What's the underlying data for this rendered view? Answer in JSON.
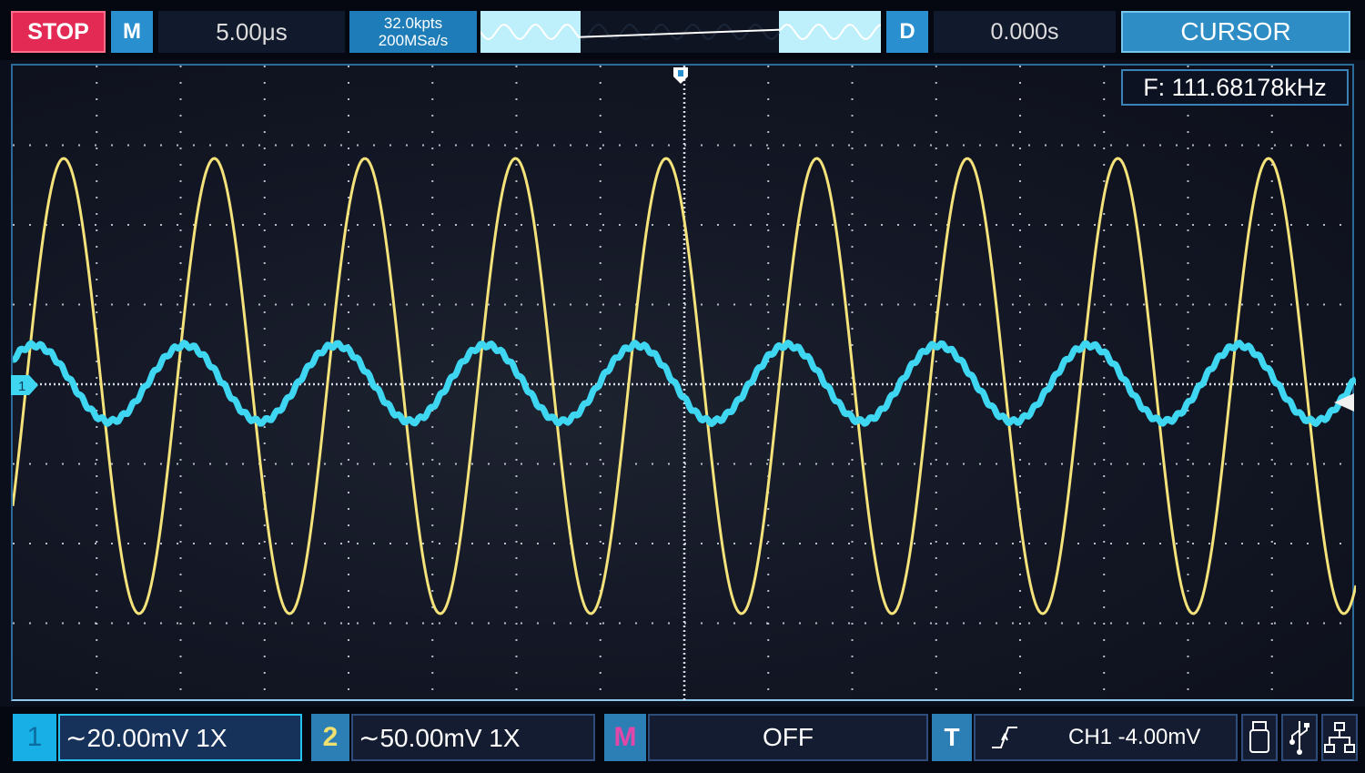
{
  "topbar": {
    "run_state": "STOP",
    "mode_label": "M",
    "timebase": "5.00μs",
    "memory_depth": "32.0kpts",
    "sample_rate": "200MSa/s",
    "delay_label": "D",
    "delay_value": "0.000s",
    "menu_button": "CURSOR"
  },
  "measurement": {
    "frequency": "F: 111.68178kHz"
  },
  "display": {
    "ch1_marker": "1",
    "ch1_color": "#3fd6f2",
    "ch2_color": "#f4e27a",
    "grid_color": "#e0e6f0"
  },
  "bottombar": {
    "ch1": {
      "number": "1",
      "scale": "∼20.00mV  1X"
    },
    "ch2": {
      "number": "2",
      "scale": "∼50.00mV  1X"
    },
    "math": {
      "label": "M",
      "state": "OFF"
    },
    "trigger": {
      "label": "T",
      "edge_icon": "rising-edge-icon",
      "info": "CH1 -4.00mV"
    },
    "icons": [
      "usb-device-icon",
      "usb-icon",
      "network-icon"
    ]
  }
}
